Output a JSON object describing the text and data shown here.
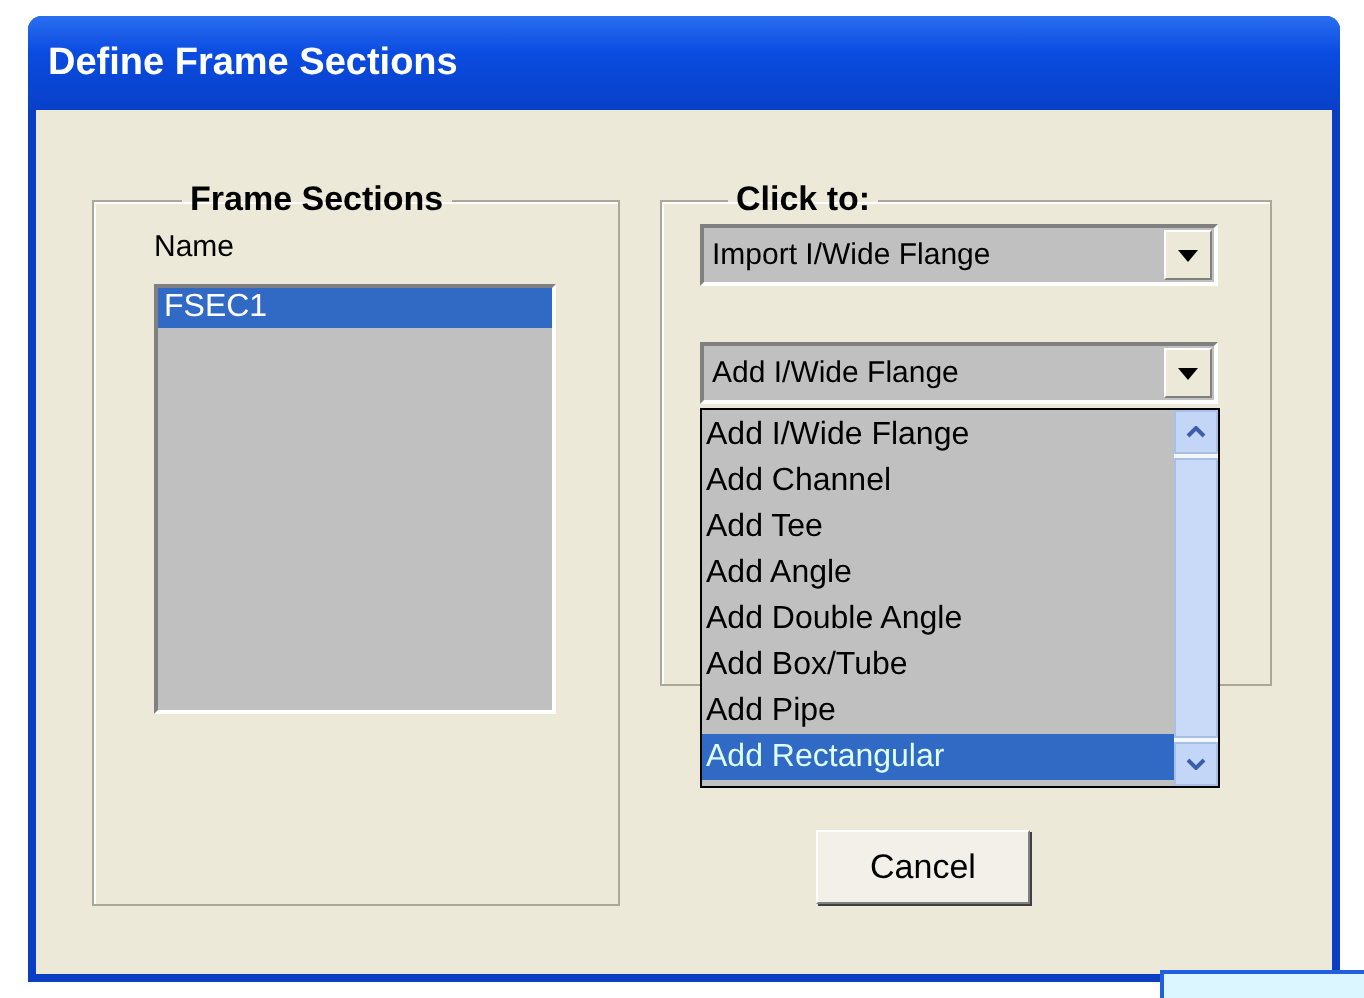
{
  "window": {
    "title": "Define Frame Sections"
  },
  "frame_sections": {
    "title": "Frame Sections",
    "name_label": "Name",
    "items": [
      {
        "label": "FSEC1",
        "selected": true
      }
    ]
  },
  "click_to": {
    "title": "Click to:",
    "import_combo": {
      "value": "Import I/Wide Flange"
    },
    "add_combo": {
      "value": "Add I/Wide Flange",
      "expanded": true,
      "options": [
        {
          "label": "Add I/Wide Flange",
          "highlighted": false
        },
        {
          "label": "Add Channel",
          "highlighted": false
        },
        {
          "label": "Add Tee",
          "highlighted": false
        },
        {
          "label": "Add Angle",
          "highlighted": false
        },
        {
          "label": "Add Double Angle",
          "highlighted": false
        },
        {
          "label": "Add Box/Tube",
          "highlighted": false
        },
        {
          "label": "Add Pipe",
          "highlighted": false
        },
        {
          "label": "Add Rectangular",
          "highlighted": true
        }
      ]
    }
  },
  "buttons": [
    {
      "label": "Cancel"
    }
  ]
}
